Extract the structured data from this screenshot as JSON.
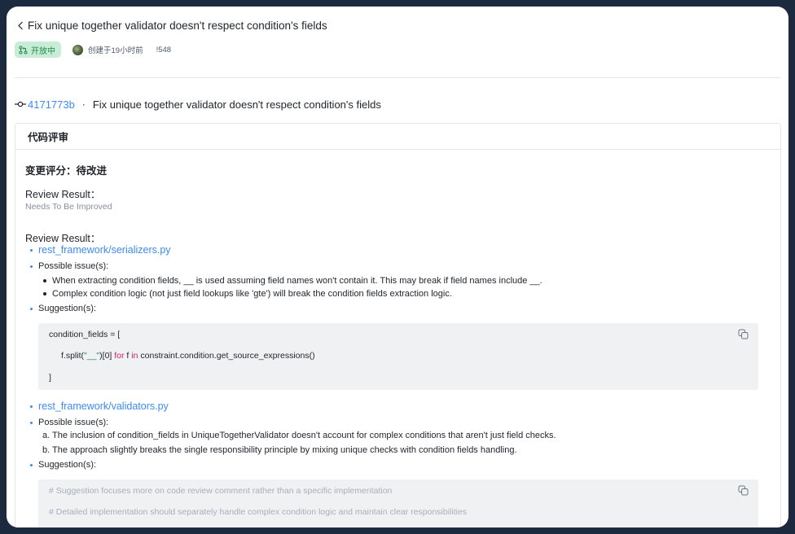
{
  "header": {
    "title": "Fix unique together validator doesn't respect condition's fields",
    "status": "开放中",
    "created": "创建于19小时前",
    "mr_id": "!548"
  },
  "commit": {
    "hash": "4171773b",
    "separator": "·",
    "message": "Fix unique together validator doesn't respect condition's fields"
  },
  "review": {
    "card_title": "代码评审",
    "score": "变更评分：待改进",
    "result_label_1": "Review Result：",
    "result_value_1": "Needs To Be Improved",
    "result_label_2": "Review Result：",
    "files": [
      {
        "name": "rest_framework/serializers.py",
        "issues_label": "Possible issue(s):",
        "issues": [
          "When extracting condition fields, __ is used assuming field names won't contain it. This may break if field names include __.",
          "Complex condition logic (not just field lookups like 'gte') will break the condition fields extraction logic."
        ],
        "suggestion_label": "Suggestion(s):",
        "code": {
          "line1": "condition_fields = [",
          "line2_a": "f.split(",
          "line2_str": "\"__\"",
          "line2_b": ")[0] ",
          "line2_kw1": "for",
          "line2_c": " f ",
          "line2_kw2": "in",
          "line2_d": " constraint.condition.get_source_expressions()",
          "line3": "]"
        }
      },
      {
        "name": "rest_framework/validators.py",
        "issues_label": "Possible issue(s):",
        "issues": [
          "a. The inclusion of condition_fields in UniqueTogetherValidator doesn't account for complex conditions that aren't just field checks.",
          "b. The approach slightly breaks the single responsibility principle by mixing unique checks with condition fields handling."
        ],
        "suggestion_label": "Suggestion(s):",
        "code": {
          "line1": "# Suggestion focuses more on code review comment rather than a specific implementation",
          "line2": "# Detailed implementation should separately handle complex condition logic and maintain clear responsibilities"
        }
      }
    ]
  },
  "colors": {
    "link": "#3c8bef",
    "badge_bg": "#c8ecd5",
    "badge_text": "#1f8a4c",
    "frame_bg": "#1c2a3f"
  }
}
